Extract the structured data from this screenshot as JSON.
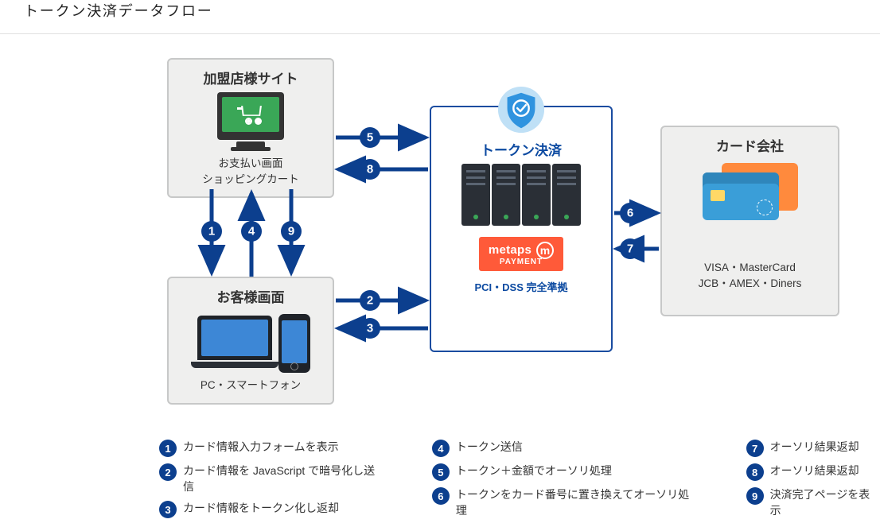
{
  "title": "トークン決済データフロー",
  "nodes": {
    "merchant": {
      "title": "加盟店様サイト",
      "sub1": "お支払い画面",
      "sub2": "ショッピングカート"
    },
    "customer": {
      "title": "お客様画面",
      "sub": "PC・スマートフォン"
    },
    "token": {
      "title": "トークン決済",
      "brand_top": "metaps",
      "brand_bottom": "PAYMENT",
      "pci": "PCI・DSS 完全準拠"
    },
    "card": {
      "title": "カード会社",
      "sub1": "VISA・MasterCard",
      "sub2": "JCB・AMEX・Diners"
    }
  },
  "flows": [
    {
      "n": 1,
      "from": "merchant",
      "to": "customer",
      "dir": "down"
    },
    {
      "n": 2,
      "from": "customer",
      "to": "token",
      "dir": "right"
    },
    {
      "n": 3,
      "from": "token",
      "to": "customer",
      "dir": "left"
    },
    {
      "n": 4,
      "from": "customer",
      "to": "merchant",
      "dir": "up"
    },
    {
      "n": 5,
      "from": "merchant",
      "to": "token",
      "dir": "right"
    },
    {
      "n": 6,
      "from": "token",
      "to": "card",
      "dir": "right"
    },
    {
      "n": 7,
      "from": "card",
      "to": "token",
      "dir": "left"
    },
    {
      "n": 8,
      "from": "token",
      "to": "merchant",
      "dir": "left"
    },
    {
      "n": 9,
      "from": "merchant",
      "to": "customer",
      "dir": "down"
    }
  ],
  "legend": [
    {
      "n": 1,
      "text": "カード情報入力フォームを表示"
    },
    {
      "n": 2,
      "text": "カード情報を JavaScript で暗号化し送信"
    },
    {
      "n": 3,
      "text": "カード情報をトークン化し返却"
    },
    {
      "n": 4,
      "text": "トークン送信"
    },
    {
      "n": 5,
      "text": "トークン＋金額でオーソリ処理"
    },
    {
      "n": 6,
      "text": "トークンをカード番号に置き換えてオーソリ処理"
    },
    {
      "n": 7,
      "text": "オーソリ結果返却"
    },
    {
      "n": 8,
      "text": "オーソリ結果返却"
    },
    {
      "n": 9,
      "text": "決済完了ページを表示"
    }
  ],
  "colors": {
    "arrow": "#0c3f8e",
    "accent_blue": "#0c4aa1",
    "brand_orange": "#ff5a39"
  }
}
